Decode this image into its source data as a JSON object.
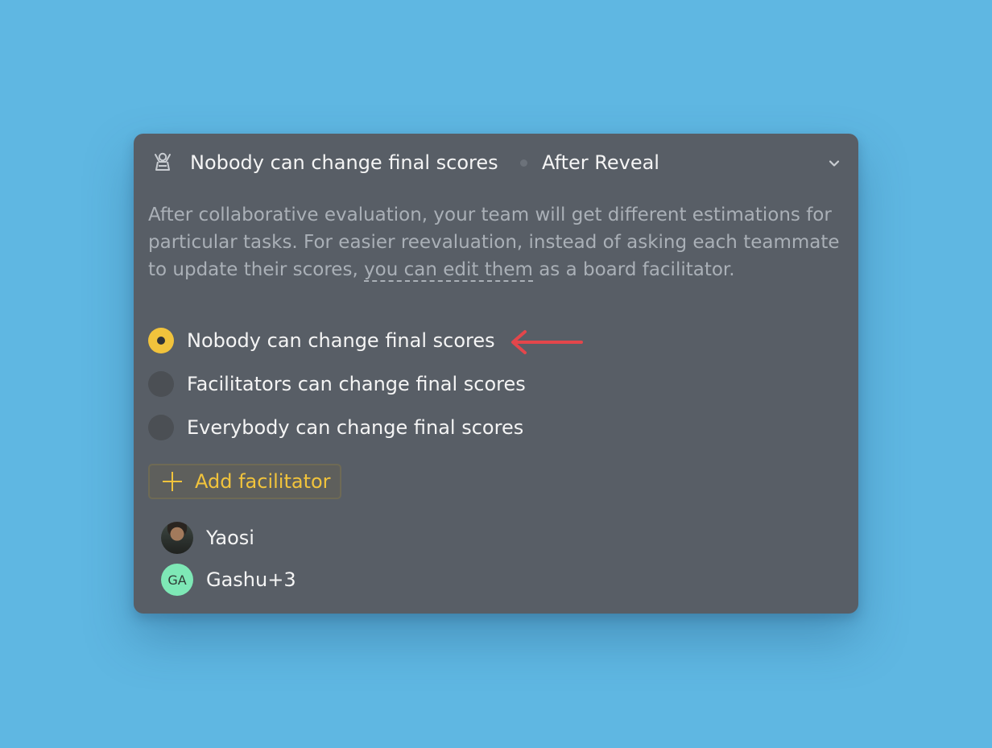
{
  "header": {
    "title": "Nobody can change final scores",
    "stage": "After Reveal",
    "icon": "facilitator-icon",
    "collapse_icon": "chevron-down-icon"
  },
  "description": {
    "before_link": "After collaborative evaluation, your team will get different estimations for particular tasks. For easier reevaluation, instead of asking each teammate to update their scores, ",
    "link": "you can edit them",
    "after_link": " as a board facilitator."
  },
  "options": [
    {
      "label": "Nobody can change final scores",
      "selected": true
    },
    {
      "label": "Facilitators can change final scores",
      "selected": false
    },
    {
      "label": "Everybody can change final scores",
      "selected": false
    }
  ],
  "add_button": {
    "label": "Add facilitator",
    "icon": "plus-icon"
  },
  "facilitators": [
    {
      "name": "Yaosi",
      "avatar": "photo"
    },
    {
      "name": "Gashu+3",
      "initials": "GA",
      "avatar": "initials"
    }
  ],
  "colors": {
    "background": "#5fb7e2",
    "panel": "#585e66",
    "accent": "#f1c33c",
    "arrow": "#e4464b",
    "initials_avatar": "#7ee8b6"
  }
}
